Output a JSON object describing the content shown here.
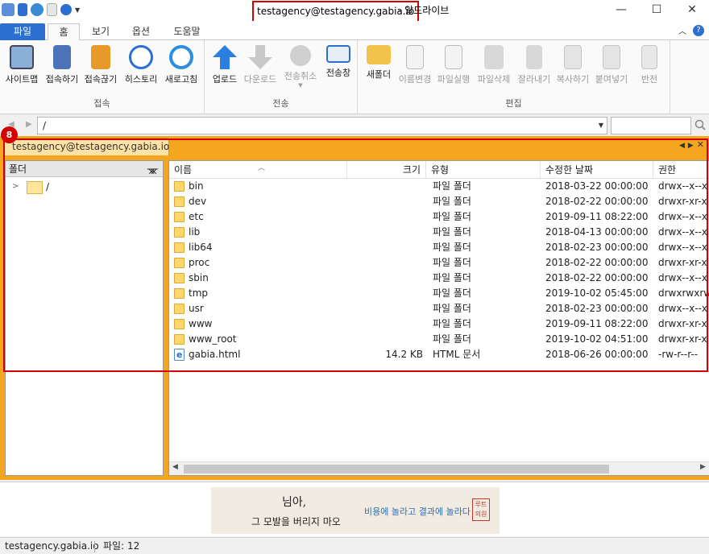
{
  "title": {
    "host": "testagency@testagency.gabia.io",
    "app": "- 알드라이브"
  },
  "window": {
    "minimize": "—",
    "maximize": "☐",
    "close": "✕"
  },
  "ribbon": {
    "tabs": [
      "파일",
      "홈",
      "보기",
      "옵션",
      "도움말"
    ],
    "groups": {
      "connect": {
        "label": "접속",
        "buttons": [
          "사이트맵",
          "접속하기",
          "접속끊기",
          "히스토리",
          "새로고침"
        ]
      },
      "transfer": {
        "label": "전송",
        "buttons": [
          "업로드",
          "다운로드",
          "전송취소",
          "전송창"
        ]
      },
      "edit": {
        "label": "편집",
        "buttons": [
          "새폴더",
          "이름변경",
          "파일실행",
          "파일삭제",
          "잘라내기",
          "복사하기",
          "붙여넣기",
          "반전"
        ]
      }
    }
  },
  "address": {
    "path": "/"
  },
  "server_tab": {
    "label": "testagency@testagency.gabia.io",
    "badge": "8"
  },
  "folder_pane": {
    "header": "폴더",
    "pin": "ᚘ",
    "tree": [
      {
        "label": "/"
      }
    ]
  },
  "list": {
    "columns": {
      "name": "이름",
      "size": "크기",
      "type": "유형",
      "modified": "수정한 날짜",
      "perm": "권한"
    },
    "rows": [
      {
        "name": "bin",
        "size": "",
        "type": "파일 폴더",
        "modified": "2018-03-22 00:00:00",
        "perm": "drwx--x--x",
        "kind": "folder"
      },
      {
        "name": "dev",
        "size": "",
        "type": "파일 폴더",
        "modified": "2018-02-22 00:00:00",
        "perm": "drwxr-xr-x",
        "kind": "folder"
      },
      {
        "name": "etc",
        "size": "",
        "type": "파일 폴더",
        "modified": "2019-09-11 08:22:00",
        "perm": "drwx--x--x",
        "kind": "folder"
      },
      {
        "name": "lib",
        "size": "",
        "type": "파일 폴더",
        "modified": "2018-04-13 00:00:00",
        "perm": "drwx--x--x",
        "kind": "folder"
      },
      {
        "name": "lib64",
        "size": "",
        "type": "파일 폴더",
        "modified": "2018-02-23 00:00:00",
        "perm": "drwx--x--x",
        "kind": "folder"
      },
      {
        "name": "proc",
        "size": "",
        "type": "파일 폴더",
        "modified": "2018-02-22 00:00:00",
        "perm": "drwxr-xr-x",
        "kind": "folder"
      },
      {
        "name": "sbin",
        "size": "",
        "type": "파일 폴더",
        "modified": "2018-02-22 00:00:00",
        "perm": "drwx--x--x",
        "kind": "folder"
      },
      {
        "name": "tmp",
        "size": "",
        "type": "파일 폴더",
        "modified": "2019-10-02 05:45:00",
        "perm": "drwxrwxrw",
        "kind": "folder"
      },
      {
        "name": "usr",
        "size": "",
        "type": "파일 폴더",
        "modified": "2018-02-23 00:00:00",
        "perm": "drwx--x--x",
        "kind": "folder"
      },
      {
        "name": "www",
        "size": "",
        "type": "파일 폴더",
        "modified": "2019-09-11 08:22:00",
        "perm": "drwxr-xr-x",
        "kind": "folder"
      },
      {
        "name": "www_root",
        "size": "",
        "type": "파일 폴더",
        "modified": "2019-10-02 04:51:00",
        "perm": "drwxr-xr-x",
        "kind": "folder"
      },
      {
        "name": "gabia.html",
        "size": "14.2 KB",
        "type": "HTML 문서",
        "modified": "2018-06-26 00:00:00",
        "perm": "-rw-r--r--",
        "kind": "html"
      }
    ]
  },
  "ad": {
    "line1": "님아,",
    "line2": "그 모발을 버리지 마오",
    "line3": "비용에 놀라고 결과에 놀라다",
    "seal": "루트의원"
  },
  "status": {
    "host": "testagency.gabia.io",
    "count": "파일: 12"
  },
  "colors": {
    "accent": "#2b6fd0",
    "tabstrip": "#f4a71e",
    "highlight": "#d40000"
  }
}
